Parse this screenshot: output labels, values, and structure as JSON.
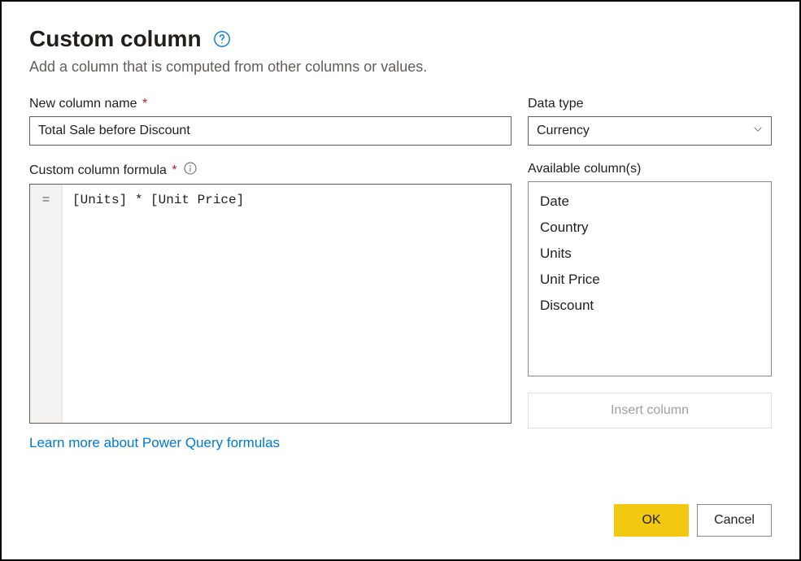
{
  "dialog": {
    "title": "Custom column",
    "description": "Add a column that is computed from other columns or values."
  },
  "columnName": {
    "label": "New column name",
    "value": "Total Sale before Discount"
  },
  "dataType": {
    "label": "Data type",
    "selected": "Currency"
  },
  "formula": {
    "label": "Custom column formula",
    "gutter": "=",
    "value": "[Units] * [Unit Price]"
  },
  "availableColumns": {
    "label": "Available column(s)",
    "items": [
      "Date",
      "Country",
      "Units",
      "Unit Price",
      "Discount"
    ],
    "insertButton": "Insert column"
  },
  "link": "Learn more about Power Query formulas",
  "buttons": {
    "ok": "OK",
    "cancel": "Cancel"
  }
}
